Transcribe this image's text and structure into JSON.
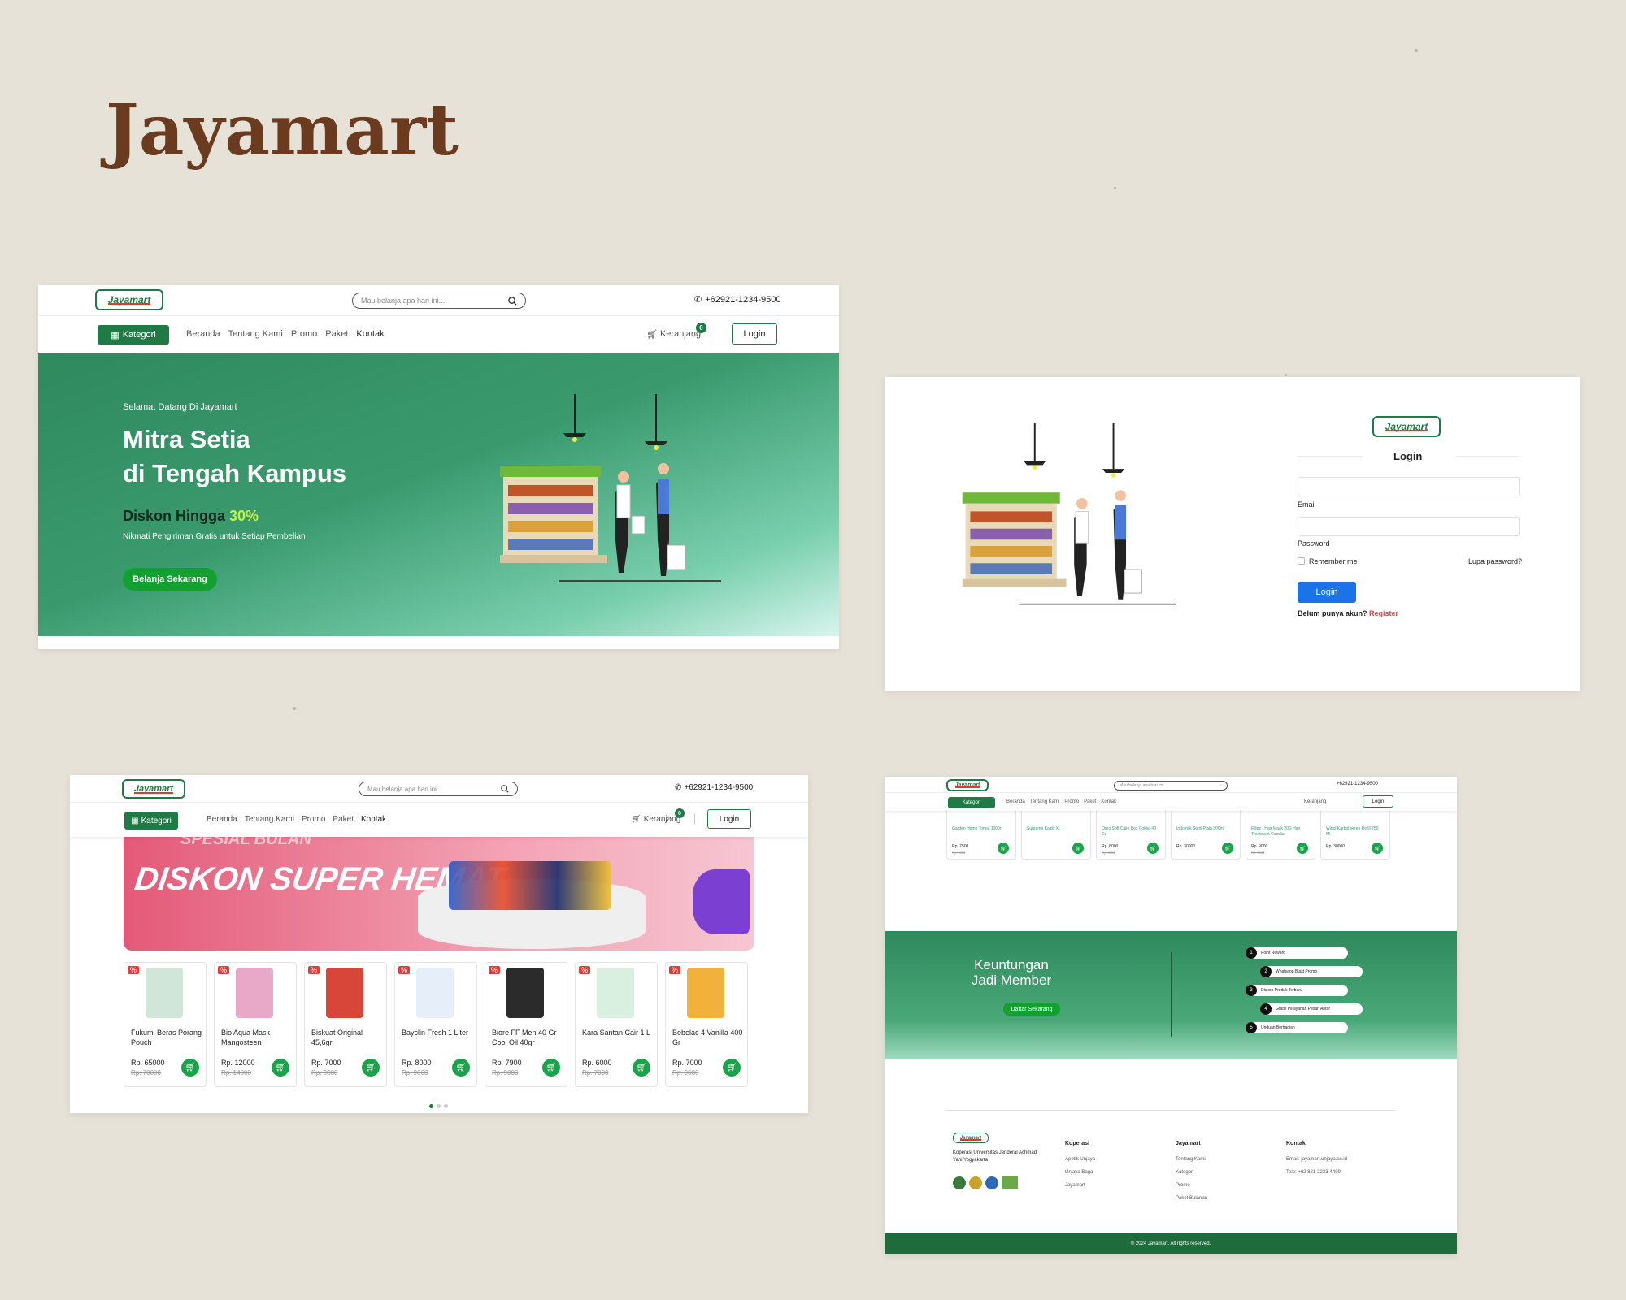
{
  "page_title": "Jayamart",
  "colors": {
    "brand_green": "#1f7a45",
    "accent_yellow": "#c8f04a",
    "discount_red": "#e23b3b",
    "login_blue": "#1a73e8"
  },
  "header": {
    "logo": "Jayamart",
    "search_placeholder": "Mau belanja apa hari ini...",
    "phone": "+62921-1234-9500",
    "kategori": "Kategori",
    "nav": [
      "Beranda",
      "Tentang Kami",
      "Promo",
      "Paket",
      "Kontak"
    ],
    "cart_label": "Keranjang",
    "cart_count": "0",
    "login": "Login"
  },
  "hero": {
    "welcome": "Selamat Datang Di Jayamart",
    "headline1": "Mitra Setia",
    "headline2": "di Tengah Kampus",
    "discount_prefix": "Diskon Hingga ",
    "discount_value": "30%",
    "sub": "Nikmati Pengiriman Gratis untuk Setiap Pembelian",
    "cta": "Belanja Sekarang"
  },
  "login_page": {
    "logo": "Jayamart",
    "title": "Login",
    "email_label": "Email",
    "password_label": "Password",
    "remember": "Remember me",
    "forgot": "Lupa password?",
    "button": "Login",
    "no_account": "Belum punya akun? ",
    "register": "Register"
  },
  "promo": {
    "banner_top": "SPESIAL BULAN",
    "banner_text": "DISKON SUPER HEMAT",
    "discount_tag": "%",
    "products": [
      {
        "name": "Fukumi Beras Porang Pouch",
        "price": "Rp. 65000",
        "old": "Rp. 70000"
      },
      {
        "name": "Bio Aqua Mask Mangosteen",
        "price": "Rp. 12000",
        "old": "Rp. 14000"
      },
      {
        "name": "Biskuat Original 45,6gr",
        "price": "Rp. 7000",
        "old": "Rp. 9000"
      },
      {
        "name": "Bayclin Fresh 1 Liter",
        "price": "Rp. 8000",
        "old": "Rp. 9000"
      },
      {
        "name": "Biore FF Men 40 Gr Cool Oil 40gr",
        "price": "Rp. 7900",
        "old": "Rp. 9000"
      },
      {
        "name": "Kara Santan Cair 1 L",
        "price": "Rp. 6000",
        "old": "Rp. 7000"
      },
      {
        "name": "Bebelac 4 Vanilla 400 Gr",
        "price": "Rp. 7000",
        "old": "Rp. 9000"
      }
    ]
  },
  "members_page": {
    "mini_products": [
      {
        "name": "Garden Home Tomat 1000r",
        "price": "Rp. 7500",
        "old": "Rp. 9000"
      },
      {
        "name": "Supreme Kaldit XL",
        "price": "",
        "old": ""
      },
      {
        "name": "Oreo Soft Cake Box Coklat 40 Gr",
        "price": "Rp. 6000",
        "old": "Rp. 9000"
      },
      {
        "name": "Indomilk Steril Plain 300ml",
        "price": "Rp. 30000",
        "old": ""
      },
      {
        "name": "Ellips - Hair Mask 20G Hair Treatment Cocolia",
        "price": "Rp. 9000",
        "old": "Rp. 9000"
      },
      {
        "name": "Wipol Karbol sereh Refill 750 Ml",
        "price": "Rp. 30000",
        "old": ""
      }
    ],
    "member_title": "Keuntungan Jadi Member",
    "member_cta": "Daftar Sekarang",
    "benefits": [
      {
        "n": "1",
        "t": "Point Reward"
      },
      {
        "n": "2",
        "t": "Whatsapp Blast Promo"
      },
      {
        "n": "3",
        "t": "Diskon Produk Terbaru"
      },
      {
        "n": "4",
        "t": "Gratis Pelayanan Pesan Antar"
      },
      {
        "n": "5",
        "t": "Unduan Berhadiah"
      }
    ],
    "footer": {
      "logo": "Jayamart",
      "about": "Koperasi Universitas Jenderal Achmad Yani Yogyakarta",
      "col1_title": "Koperasi",
      "col1": [
        "Apotik Unjaya",
        "Unjaya Baga",
        "Jayamart"
      ],
      "col2_title": "Jayamart",
      "col2": [
        "Tentang Kami",
        "Kategori",
        "Promo",
        "Paket Bulanan"
      ],
      "col3_title": "Kontak",
      "col3": [
        "Email: jayamart.unjaya.ac.id",
        "Telp: +62 821-2233-4499"
      ],
      "copyright": "© 2024 Jayamart. All rights reserved."
    }
  }
}
